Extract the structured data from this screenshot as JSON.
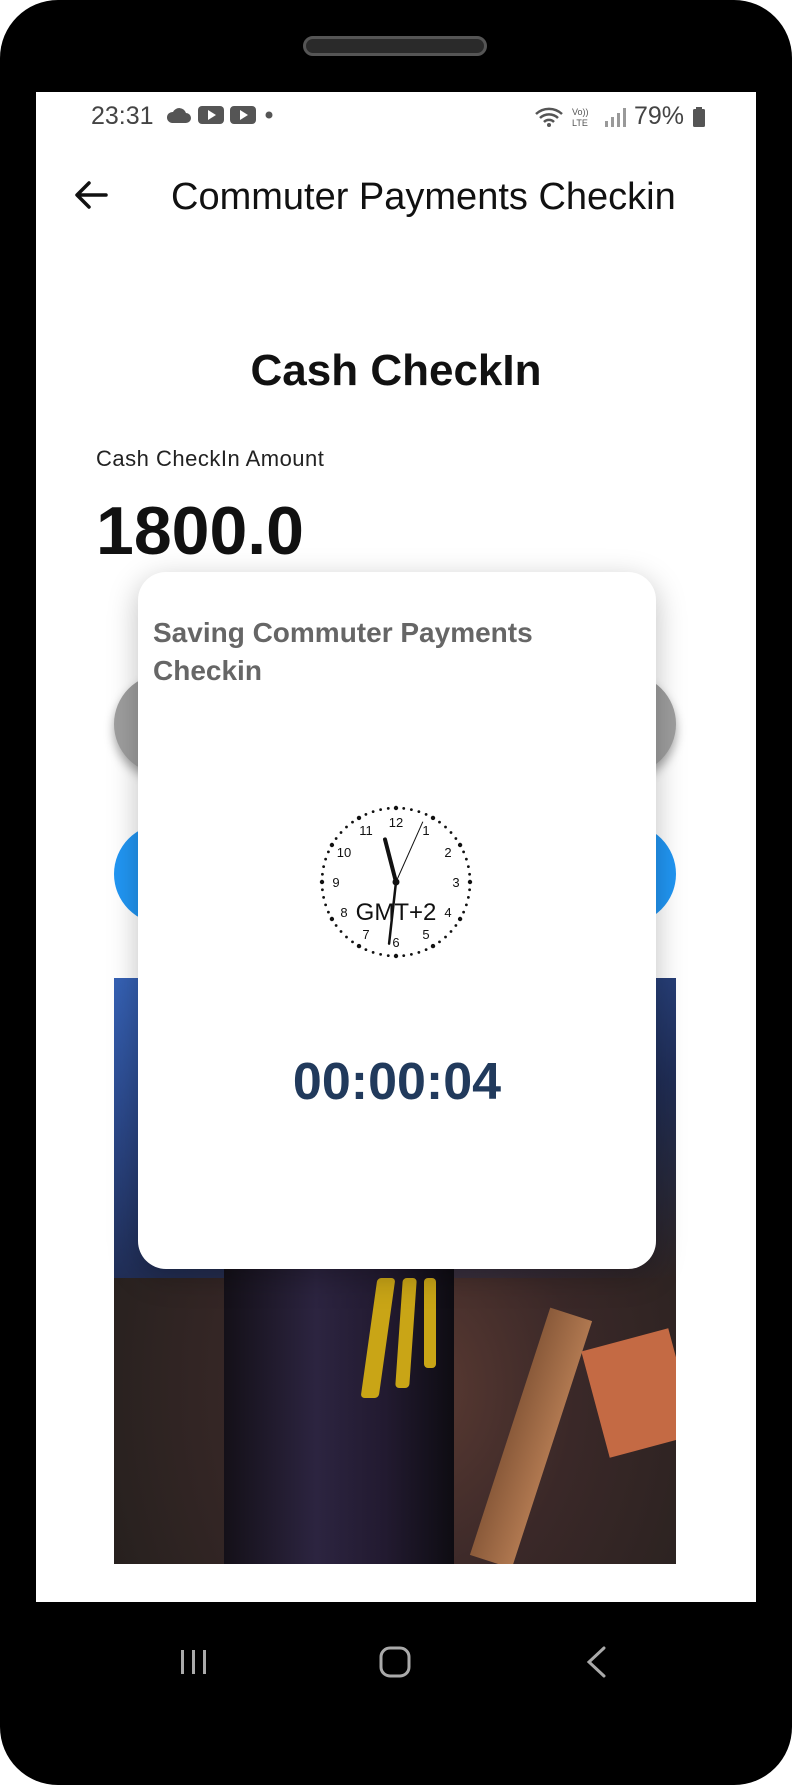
{
  "status_bar": {
    "time": "23:31",
    "battery": "79%"
  },
  "app_bar": {
    "title": "Commuter Payments Checkin",
    "back_icon": "arrow-left-icon"
  },
  "main": {
    "heading": "Cash CheckIn",
    "amount_label": "Cash CheckIn Amount",
    "amount_value": "1800.0"
  },
  "dialog": {
    "title": "Saving Commuter Payments Checkin",
    "clock": {
      "timezone": "GMT+2",
      "hour": 11,
      "minute": 31,
      "second": 4,
      "numbers": [
        "12",
        "1",
        "2",
        "3",
        "4",
        "5",
        "6",
        "7",
        "8",
        "9",
        "10",
        "11"
      ]
    },
    "timer": "00:00:04"
  },
  "colors": {
    "primary_button": "#2196f3",
    "secondary_button": "#9e9e9e",
    "timer_text": "#213a5c",
    "dialog_title": "#666666"
  },
  "nav": {
    "recents_icon": "recents-icon",
    "home_icon": "home-icon",
    "back_icon": "back-chevron-icon"
  }
}
